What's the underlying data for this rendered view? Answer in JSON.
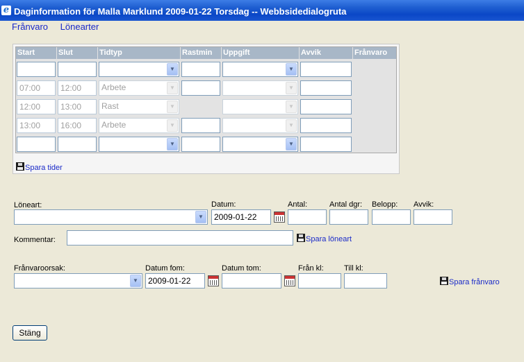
{
  "window": {
    "title": "Daginformation för Malla Marklund 2009-01-22 Torsdag -- Webbsidedialogruta",
    "icon": "ie-icon"
  },
  "nav": {
    "absence_link": "Frånvaro",
    "wage_types_link": "Lönearter"
  },
  "time_grid": {
    "headers": [
      "Start",
      "Slut",
      "Tidtyp",
      "Rastmin",
      "Uppgift",
      "Avvik",
      "Frånvaro"
    ],
    "rows": [
      {
        "start": "",
        "end": "",
        "type": "",
        "break": "",
        "task": "",
        "deviation": "",
        "enabled": true
      },
      {
        "start": "07:00",
        "end": "12:00",
        "type": "Arbete",
        "break": "",
        "task": "",
        "deviation": "",
        "enabled": false
      },
      {
        "start": "12:00",
        "end": "13:00",
        "type": "Rast",
        "break": "",
        "task": "",
        "deviation": "",
        "enabled": false
      },
      {
        "start": "13:00",
        "end": "16:00",
        "type": "Arbete",
        "break": "",
        "task": "",
        "deviation": "",
        "enabled": false
      },
      {
        "start": "",
        "end": "",
        "type": "",
        "break": "",
        "task": "",
        "deviation": "",
        "enabled": true
      }
    ],
    "save_label": "Spara tider"
  },
  "wage": {
    "type_label": "Löneart:",
    "date_label": "Datum:",
    "date_value": "2009-01-22",
    "qty_label": "Antal:",
    "days_label": "Antal dgr:",
    "amount_label": "Belopp:",
    "deviation_label": "Avvik:",
    "comment_label": "Kommentar:",
    "save_label": "Spara löneart"
  },
  "absence": {
    "reason_label": "Frånvaroorsak:",
    "from_date_label": "Datum fom:",
    "from_date_value": "2009-01-22",
    "to_date_label": "Datum tom:",
    "from_time_label": "Från kl:",
    "to_time_label": "Till kl:",
    "save_label": "Spara frånvaro"
  },
  "close_button": "Stäng"
}
